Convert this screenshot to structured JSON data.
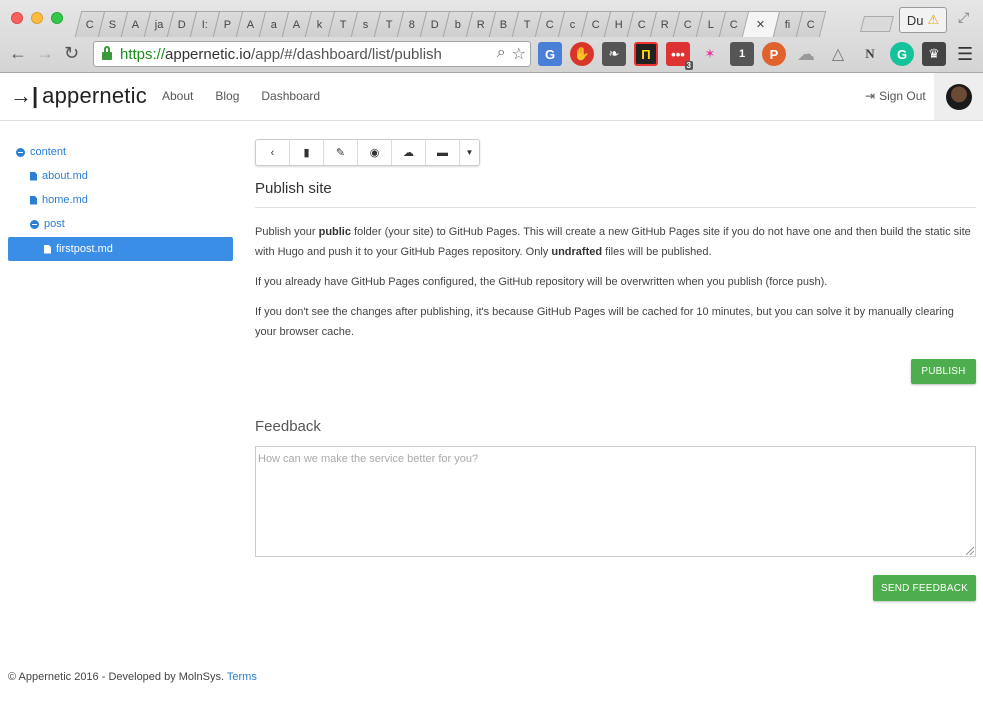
{
  "browser": {
    "tabs": [
      "C",
      "S",
      "A",
      "ja",
      "D",
      "I:",
      "P",
      "A",
      "a",
      "A",
      "k",
      "T",
      "s",
      "T",
      "8",
      "D",
      "b",
      "R",
      "B",
      "T",
      "C",
      "c",
      "C",
      "H",
      "C",
      "R",
      "C",
      "L",
      "C",
      "",
      "fi",
      "C"
    ],
    "active_tab_index": 29,
    "ext_button_label": "Du",
    "url_scheme": "https://",
    "url_host": "appernetic.io",
    "url_path": "/app/#/dashboard/list/publish",
    "extension_badge": "3",
    "extension_box_label": "1",
    "extension_p_label": "P",
    "extension_n_label": "N"
  },
  "app": {
    "brand_mark": "→|",
    "brand_name": "appernetic",
    "nav": [
      "About",
      "Blog",
      "Dashboard"
    ],
    "sign_out": "Sign Out"
  },
  "tree": [
    {
      "label": "content",
      "type": "folder",
      "indent": 0,
      "selected": false
    },
    {
      "label": "about.md",
      "type": "file",
      "indent": 1,
      "selected": false
    },
    {
      "label": "home.md",
      "type": "file",
      "indent": 1,
      "selected": false
    },
    {
      "label": "post",
      "type": "folder",
      "indent": 1,
      "selected": false
    },
    {
      "label": "firstpost.md",
      "type": "file",
      "indent": 2,
      "selected": true
    }
  ],
  "toolbar_icons": [
    "back-icon",
    "file-icon",
    "pencil-icon",
    "eye-icon",
    "cloud-upload-icon",
    "computer-icon",
    "caret-down-icon"
  ],
  "publish": {
    "title": "Publish site",
    "p1_a": "Publish your ",
    "p1_b": "public",
    "p1_c": " folder (your site) to GitHub Pages. This will create a new GitHub Pages site if you do not have one and then build the static site with Hugo and push it to your GitHub Pages repository. Only ",
    "p1_d": "undrafted",
    "p1_e": " files will be published.",
    "p2": "If you already have GitHub Pages configured, the GitHub repository will be overwritten when you publish (force push).",
    "p3": "If you don't see the changes after publishing, it's because GitHub Pages will be cached for 10 minutes, but you can solve it by manually clearing your browser cache.",
    "button": "PUBLISH"
  },
  "feedback": {
    "title": "Feedback",
    "placeholder": "How can we make the service better for you?",
    "button": "SEND FEEDBACK"
  },
  "footer": {
    "text": "© Appernetic 2016 - Developed by MolnSys.",
    "link": "Terms"
  },
  "colors": {
    "link": "#2a7fd4",
    "selected": "#3a8ee6",
    "green_button": "#4cae4c"
  }
}
